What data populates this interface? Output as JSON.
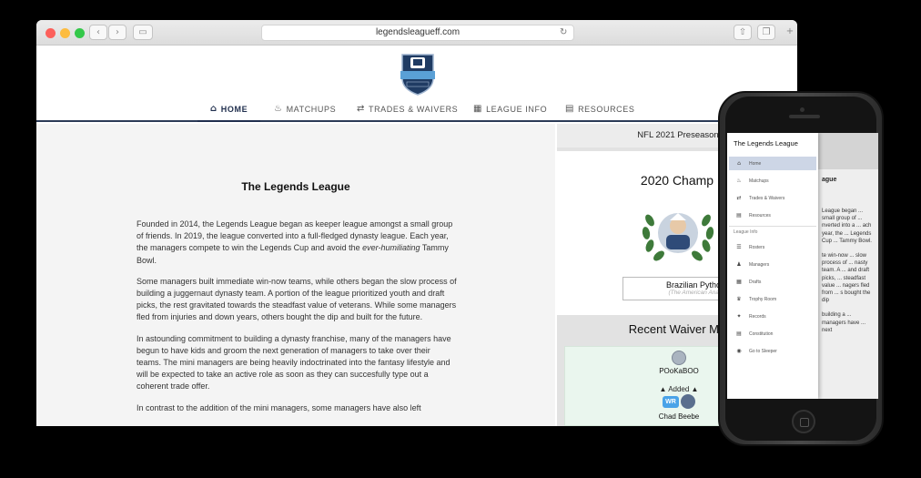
{
  "browser": {
    "url": "legendsleagueff.com",
    "back_icon": "chevron-left-icon",
    "forward_icon": "chevron-right-icon"
  },
  "nav": {
    "items": [
      {
        "label": "HOME",
        "icon": "home-icon",
        "glyph": "⌂"
      },
      {
        "label": "MATCHUPS",
        "icon": "flame-icon",
        "glyph": "♨"
      },
      {
        "label": "TRADES & WAIVERS",
        "icon": "swap-icon",
        "glyph": "⇄"
      },
      {
        "label": "LEAGUE INFO",
        "icon": "grid-icon",
        "glyph": "▦"
      },
      {
        "label": "RESOURCES",
        "icon": "document-icon",
        "glyph": "▤"
      }
    ]
  },
  "main": {
    "title": "The Legends League",
    "paragraphs": [
      {
        "pre": "Founded in 2014, the Legends League began as keeper league amongst a small group of friends. In 2019, the league converted into a full-fledged dynasty league. Each year, the managers compete to win the Legends Cup and avoid the ",
        "em": "ever-humiliating",
        "post": " Tammy Bowl."
      },
      {
        "pre": "Some managers built immediate win-now teams, while others began the slow process of building a juggernaut dynasty team. A portion of the league prioritized youth and draft picks, the rest gravitated towards the steadfast value of veterans. While some managers fled from injuries and down years, others bought the dip and built for the future.",
        "em": "",
        "post": ""
      },
      {
        "pre": "In astounding commitment to building a dynasty franchise, many of the managers have begun to have kids and groom the next generation of managers to take over their teams. The mini managers are being heavily indoctrinated into the fantasy lifestyle and will be expected to take an active role as soon as they can succesfully type out a coherent trade offer.",
        "em": "",
        "post": ""
      },
      {
        "pre": "In contrast to the addition of the mini managers, some managers have also left",
        "em": "",
        "post": ""
      }
    ]
  },
  "sidebar": {
    "preseason": "NFL 2021 Preseason",
    "champ_title": "2020 Champ",
    "champ_name": "Brazilian Pythons FC",
    "champ_sub": "(The American Anaconda F",
    "waiver_title": "Recent Waiver Mo",
    "waiver": {
      "user": "POoKaBOO",
      "action": "▲  Added  ▲",
      "position": "WR",
      "player": "Chad Beebe"
    }
  },
  "phone": {
    "drawer_title": "The Legends League",
    "items": [
      {
        "label": "Home",
        "icon": "home-icon",
        "glyph": "⌂"
      },
      {
        "label": "Matchups",
        "icon": "flame-icon",
        "glyph": "♨"
      },
      {
        "label": "Trades & Waivers",
        "icon": "swap-icon",
        "glyph": "⇄"
      },
      {
        "label": "Resources",
        "icon": "document-icon",
        "glyph": "▤"
      }
    ],
    "league_info_label": "League Info",
    "league_items": [
      {
        "label": "Rosters",
        "icon": "list-icon",
        "glyph": "☰"
      },
      {
        "label": "Managers",
        "icon": "people-icon",
        "glyph": "♟"
      },
      {
        "label": "Drafts",
        "icon": "table-icon",
        "glyph": "▦"
      },
      {
        "label": "Trophy Room",
        "icon": "trophy-icon",
        "glyph": "♛"
      },
      {
        "label": "Records",
        "icon": "award-icon",
        "glyph": "✦"
      },
      {
        "label": "Constitution",
        "icon": "book-icon",
        "glyph": "▤"
      },
      {
        "label": "Go to Sleeper",
        "icon": "sleeper-icon",
        "glyph": "◉"
      }
    ],
    "bg_heading": "ague",
    "bg_paragraphs": [
      "League began ... small group of ... nverted into a ... ach year, the ... Legends Cup ... Tammy Bowl.",
      "te win-now ... slow process of ... nasty team. A ... and draft picks, ... steadfast value ... nagers fled from ... s bought the dip",
      "building a ... managers have ... next"
    ]
  }
}
